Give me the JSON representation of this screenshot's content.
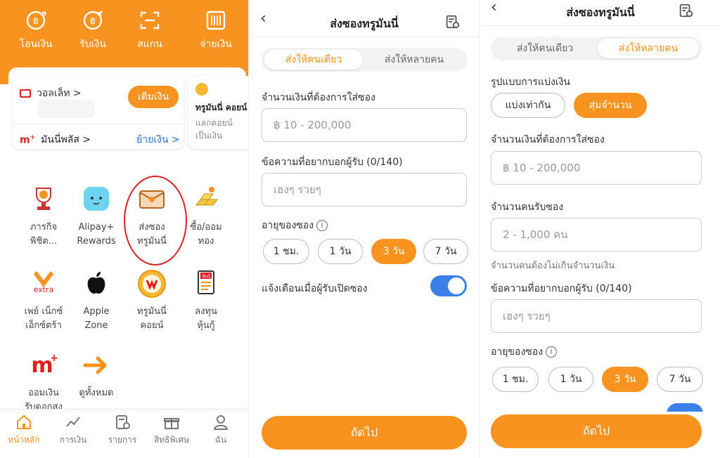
{
  "colors": {
    "accent": "#f7931e",
    "toggle": "#3b7fe8",
    "annotation": "#e02020"
  },
  "home": {
    "top_actions": [
      {
        "label": "โอนเงิน",
        "icon": "transfer-icon"
      },
      {
        "label": "รับเงิน",
        "icon": "receive-icon"
      },
      {
        "label": "สแกน",
        "icon": "scan-icon"
      },
      {
        "label": "จ่ายเงิน",
        "icon": "barcode-icon"
      }
    ],
    "wallet_label": "วอลเล็ท >",
    "topup": "เติมเงิน",
    "moneyplus": "มันนี่พลัส >",
    "move_money": "ย้ายเงิน >",
    "coin_title": "ทรูมันนี่ คอยน์",
    "coin_sub1": "แลกคอยน์",
    "coin_sub2": "เป็นเงิน",
    "grid": [
      {
        "l1": "ภารกิจ",
        "l2": "พิชิต...",
        "icon": "trophy-icon"
      },
      {
        "l1": "Alipay+",
        "l2": "Rewards",
        "icon": "alipay-mascot-icon"
      },
      {
        "l1": "ส่งซอง",
        "l2": "ทรูมันนี่",
        "icon": "envelope-icon"
      },
      {
        "l1": "ซื้อ/ออม",
        "l2": "ทอง",
        "icon": "gold-bars-icon"
      },
      {
        "l1": "เพย์ เน็กซ์",
        "l2": "เอ็กซ์ตร้า",
        "icon": "paynext-extra-icon"
      },
      {
        "l1": "Apple",
        "l2": "Zone",
        "icon": "apple-icon"
      },
      {
        "l1": "ทรูมันนี่",
        "l2": "คอยน์",
        "icon": "truemoney-coin-icon"
      },
      {
        "l1": "ลงทุน",
        "l2": "หุ้นกู้",
        "icon": "bond-doc-icon"
      },
      {
        "l1": "ออมเงิน",
        "l2": "รับดอกสูง",
        "icon": "moneyplus-icon"
      },
      {
        "l1": "ดูทั้งหมด",
        "l2": "",
        "icon": "arrow-right-icon"
      }
    ],
    "extra_text": "extra",
    "bond_badge": "หุ้นกู้",
    "nav": [
      {
        "label": "หน้าหลัก",
        "icon": "home-icon"
      },
      {
        "label": "การเงิน",
        "icon": "finance-icon"
      },
      {
        "label": "รายการ",
        "icon": "history-icon"
      },
      {
        "label": "สิทธิพิเศษ",
        "icon": "gift-icon"
      },
      {
        "label": "ฉัน",
        "icon": "profile-icon"
      }
    ]
  },
  "form1": {
    "title": "ส่งซองทรูมันนี่",
    "tab_single": "ส่งให้คนเดียว",
    "tab_multi": "ส่งให้หลายคน",
    "amount_label": "จำนวนเงินที่ต้องการใส่ซอง",
    "amount_placeholder": "฿ 10 - 200,000",
    "message_label": "ข้อความที่อยากบอกผู้รับ (0/140)",
    "message_placeholder": "เฮงๆ รวยๆ",
    "age_label": "อายุของซอง",
    "ages": [
      "1 ชม.",
      "1 วัน",
      "3 วัน",
      "7 วัน"
    ],
    "selected_age": "3 วัน",
    "notify_label": "แจ้งเตือนเมื่อผู้รับเปิดซอง",
    "next": "ถัดไป"
  },
  "form2": {
    "title": "ส่งซองทรูมันนี่",
    "tab_single": "ส่งให้คนเดียว",
    "tab_multi": "ส่งให้หลายคน",
    "split_label": "รูปแบบการแบ่งเงิน",
    "split_equal": "แบ่งเท่ากัน",
    "split_random": "สุ่มจำนวน",
    "amount_label": "จำนวนเงินที่ต้องการใส่ซอง",
    "amount_placeholder": "฿ 10 - 200,000",
    "count_label": "จำนวนคนรับซอง",
    "count_placeholder": "2 - 1,000 คน",
    "count_hint": "จำนวนคนต้องไม่เกินจำนวนเงิน",
    "message_label": "ข้อความที่อยากบอกผู้รับ (0/140)",
    "message_placeholder": "เฮงๆ รวยๆ",
    "age_label": "อายุของซอง",
    "ages": [
      "1 ชม.",
      "1 วัน",
      "3 วัน",
      "7 วัน"
    ],
    "selected_age": "3 วัน",
    "next": "ถัดไป"
  }
}
